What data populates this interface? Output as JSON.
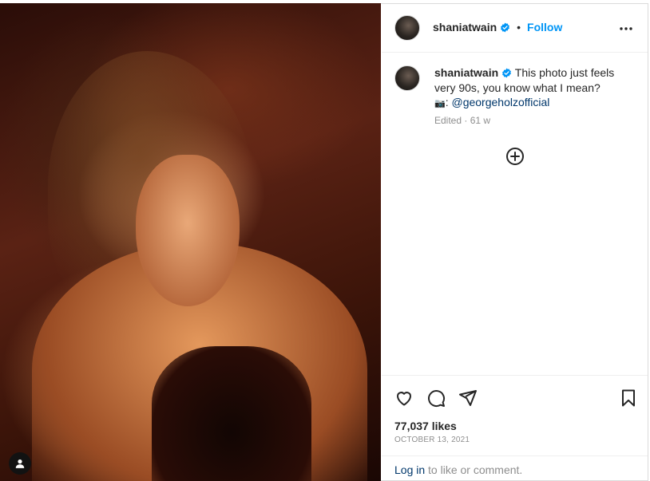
{
  "post": {
    "username": "shaniatwain",
    "follow_label": "Follow",
    "more_icon": "more-horizontal-icon",
    "caption_username": "shaniatwain",
    "caption_text": "This photo just feels very 90s, you know what I mean?",
    "caption_camera": "📷",
    "caption_mention": "@georgeholzofficial",
    "edited_meta": "Edited · 61 w",
    "likes": "77,037 likes",
    "date": "OCTOBER 13, 2021"
  },
  "footer": {
    "login_link": "Log in",
    "login_rest": " to like or comment."
  },
  "icons": {
    "like": "heart-icon",
    "comment": "comment-icon",
    "share": "send-icon",
    "save": "bookmark-icon",
    "add": "plus-circle-icon",
    "tag": "user-tag-icon"
  },
  "colors": {
    "link": "#0095f6",
    "mention": "#00376b",
    "muted": "#8e8e8e",
    "text": "#262626"
  }
}
